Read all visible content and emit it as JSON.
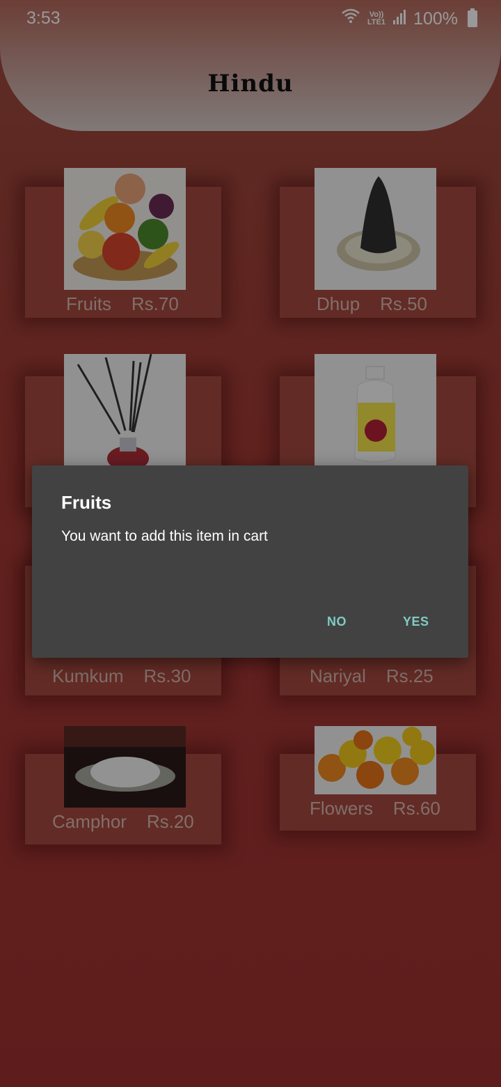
{
  "status_bar": {
    "time": "3:53",
    "network": "LTE1",
    "network_top": "Vo))",
    "battery": "100%"
  },
  "header": {
    "title": "Hindu"
  },
  "products": [
    {
      "name": "Fruits",
      "price": "Rs.70"
    },
    {
      "name": "Dhup",
      "price": "Rs.50"
    },
    {
      "name": "Kumkum",
      "price": "Rs.30"
    },
    {
      "name": "Nariyal",
      "price": "Rs.25"
    },
    {
      "name": "Camphor",
      "price": "Rs.20"
    },
    {
      "name": "Flowers",
      "price": "Rs.60"
    }
  ],
  "dialog": {
    "title": "Fruits",
    "message": "You want to add this item in cart",
    "negative": "NO",
    "positive": "YES"
  },
  "colors": {
    "background": "#9f3030",
    "dialog_bg": "#424242",
    "dialog_accent": "#80cbc4"
  }
}
